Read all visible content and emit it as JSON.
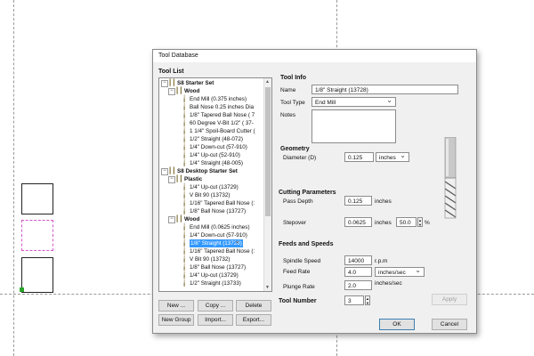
{
  "dialog": {
    "title": "Tool Database",
    "tool_list_label": "Tool List",
    "tree": [
      {
        "text": "S8 Starter Set",
        "kind": "set",
        "bold": true
      },
      {
        "text": "Wood",
        "kind": "folder",
        "bold": true
      },
      {
        "text": "End Mill (0.375 inches)",
        "kind": "tool"
      },
      {
        "text": "Ball Nose 0.25 inches Dia",
        "kind": "tool"
      },
      {
        "text": "1/8\" Tapered Ball Nose ( 7",
        "kind": "tool"
      },
      {
        "text": "60 Degree V-Bit 1/2\" ( 37-",
        "kind": "tool"
      },
      {
        "text": "1 1/4\" Spoil-Board Cutter (",
        "kind": "tool"
      },
      {
        "text": "1/2\" Straight (48-072)",
        "kind": "tool"
      },
      {
        "text": "1/4\" Down-cut (57-910)",
        "kind": "tool"
      },
      {
        "text": "1/4\" Up-cut (52-910)",
        "kind": "tool"
      },
      {
        "text": "1/4\" Straight (48-005)",
        "kind": "tool"
      },
      {
        "text": "S8 Desktop Starter Set",
        "kind": "set",
        "bold": true
      },
      {
        "text": "Plastic",
        "kind": "folder",
        "bold": true
      },
      {
        "text": "1/4\" Up-cut (13729)",
        "kind": "tool"
      },
      {
        "text": "V Bit 90 (13732)",
        "kind": "tool"
      },
      {
        "text": "1/16\" Tapered Ball Nose (:",
        "kind": "tool"
      },
      {
        "text": "1/8\" Ball Nose (13727)",
        "kind": "tool"
      },
      {
        "text": "Wood",
        "kind": "folder",
        "bold": true
      },
      {
        "text": "End Mill (0.0625 inches)",
        "kind": "tool"
      },
      {
        "text": "1/4\" Down-cut (57-910)",
        "kind": "tool"
      },
      {
        "text": "1/8\" Straight (13728)",
        "kind": "tool",
        "selected": true
      },
      {
        "text": "1/16\" Tapered Ball Nose (:",
        "kind": "tool"
      },
      {
        "text": "V Bit 90 (13732)",
        "kind": "tool"
      },
      {
        "text": "1/8\" Ball Nose (13727)",
        "kind": "tool"
      },
      {
        "text": "1/4\" Up-cut (13729)",
        "kind": "tool"
      },
      {
        "text": "1/2\" Straight (13733)",
        "kind": "tool"
      }
    ],
    "buttons": {
      "new": "New ...",
      "copy": "Copy ...",
      "delete": "Delete",
      "new_group": "New Group",
      "import": "Import...",
      "export": "Export..."
    },
    "tool_info": {
      "heading": "Tool Info",
      "name_label": "Name",
      "name_value": "1/8\" Straight (13728)",
      "type_label": "Tool Type",
      "type_value": "End Mill",
      "notes_label": "Notes",
      "notes_value": ""
    },
    "geometry": {
      "heading": "Geometry",
      "diameter_label": "Diameter (D)",
      "diameter_value": "0.125",
      "diameter_units": "inches"
    },
    "cutting": {
      "heading": "Cutting Parameters",
      "pass_depth_label": "Pass Depth",
      "pass_depth_value": "0.125",
      "pass_depth_units": "inches",
      "stepover_label": "Stepover",
      "stepover_value": "0.0625",
      "stepover_units": "inches",
      "stepover_pct": "50.0",
      "pct_symbol": "%"
    },
    "feeds": {
      "heading": "Feeds and Speeds",
      "spindle_label": "Spindle Speed",
      "spindle_value": "14000",
      "spindle_units": "r.p.m",
      "feed_label": "Feed Rate",
      "feed_value": "4.0",
      "feed_units": "inches/sec",
      "plunge_label": "Plunge Rate",
      "plunge_value": "2.0",
      "plunge_units": "inches/sec"
    },
    "tool_number_label": "Tool Number",
    "tool_number_value": "3",
    "apply": "Apply",
    "ok": "OK",
    "cancel": "Cancel"
  },
  "colors": {
    "selection": "#3399ff",
    "dialog_bg": "#f0f0f0"
  }
}
